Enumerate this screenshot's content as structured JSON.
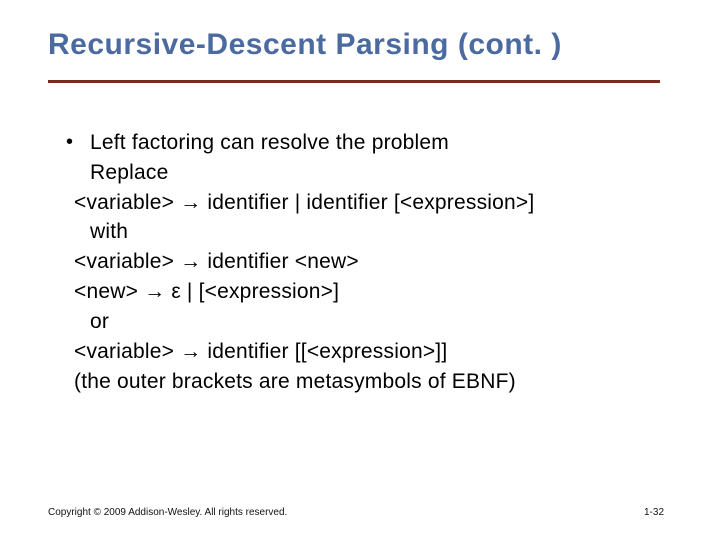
{
  "title": "Recursive-Descent Parsing (cont. )",
  "bullet": "Left factoring can resolve the problem",
  "lines": {
    "replace": "Replace",
    "rule1": "<variable> → identifier  |  identifier [<expression>]",
    "with": "with",
    "rule2": "<variable> → identifier <new>",
    "rule3": "<new> → ε  |  [<expression>]",
    "or": "or",
    "rule4": "<variable> → identifier [[<expression>]]",
    "note": "(the outer brackets are metasymbols of EBNF)"
  },
  "footer": "Copyright © 2009 Addison-Wesley. All rights reserved.",
  "pagenum": "1-32"
}
